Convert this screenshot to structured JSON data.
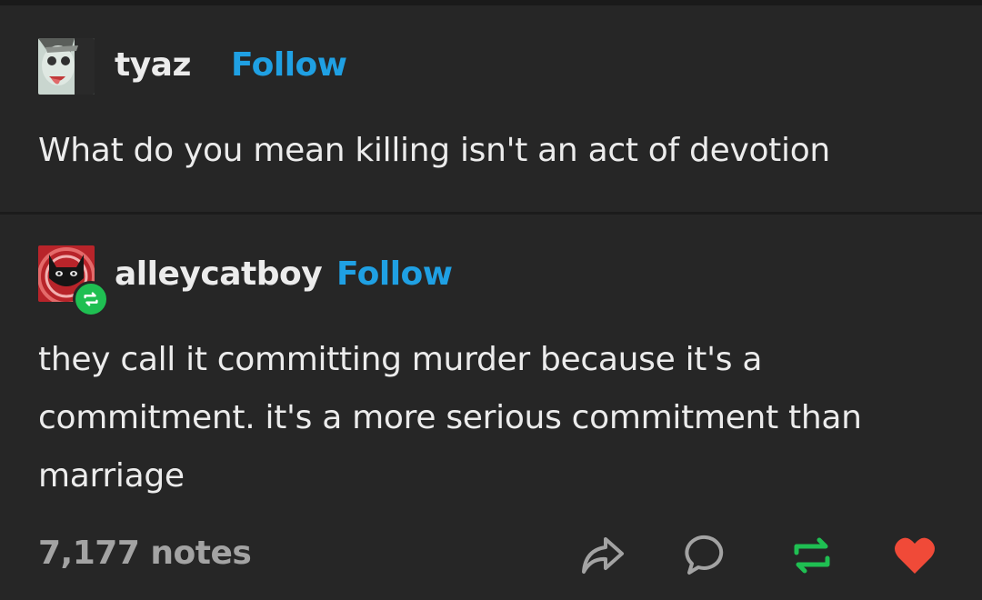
{
  "posts": [
    {
      "username": "tyaz",
      "follow_label": "Follow",
      "avatar_icon": "anime-face-avatar-icon",
      "text": "What do you mean killing isn't an act of devotion"
    },
    {
      "username": "alleycatboy",
      "follow_label": "Follow",
      "avatar_icon": "black-cat-avatar-icon",
      "badge_icon": "reblog-badge-icon",
      "text_lines": [
        "they call it committing murder because it's a",
        "commitment. it's a more serious commitment than",
        "marriage"
      ]
    }
  ],
  "footer": {
    "notes": "7,177 notes",
    "actions": [
      {
        "icon": "share-icon"
      },
      {
        "icon": "comment-icon"
      },
      {
        "icon": "reblog-icon",
        "color": "#1fbf52"
      },
      {
        "icon": "heart-icon",
        "color": "#f04a38"
      }
    ]
  },
  "colors": {
    "background": "#262626",
    "accent": "#1fa0e3",
    "reblog": "#1fbf52",
    "like": "#f04a38"
  }
}
